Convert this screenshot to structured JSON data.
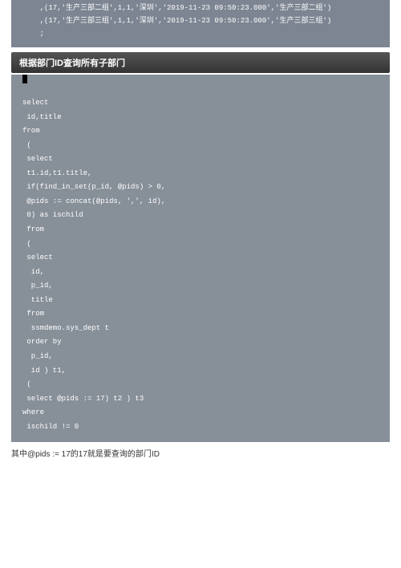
{
  "topCode": {
    "line1": "    ,(17,'生产三部二组',1,1,'深圳','2019-11-23 09:50:23.000','生产三部二组')",
    "line2": "    ,(17,'生产三部三组',1,1,'深圳','2019-11-23 09:50:23.000','生产三部三组')",
    "line3": "    ;"
  },
  "sectionHeader": "根据部门ID查询所有子部门",
  "mainCode": {
    "l1": "select",
    "l2": " id,title",
    "l3": "from",
    "l4": " (",
    "l5": " select",
    "l6": " t1.id,t1.title,",
    "l7": " if(find_in_set(p_id, @pids) > 0,",
    "l8": " @pids := concat(@pids, ',', id),",
    "l9": " 0) as ischild",
    "l10": " from",
    "l11": " (",
    "l12": " select",
    "l13": "  id,",
    "l14": "  p_id,",
    "l15": "  title",
    "l16": " from",
    "l17": "  ssmdemo.sys_dept t",
    "l18": " order by",
    "l19": "  p_id,",
    "l20": "  id ) t1,",
    "l21": " (",
    "l22": " select @pids := 17) t2 ) t3",
    "l23": "where",
    "l24": " ischild != 0"
  },
  "footnote": "其中@pids := 17的17就是要查询的部门ID"
}
